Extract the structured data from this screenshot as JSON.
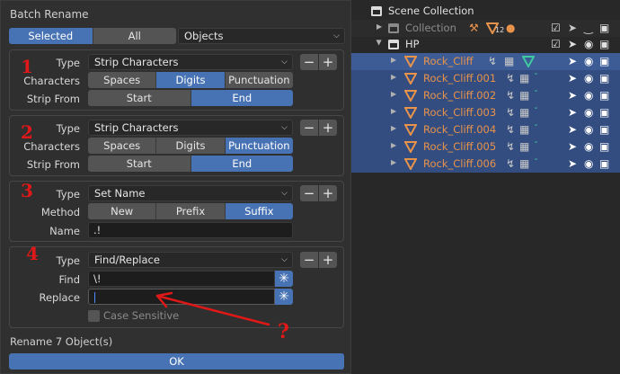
{
  "dialog": {
    "title": "Batch Rename",
    "target_tabs": [
      {
        "label": "Selected",
        "active": true
      },
      {
        "label": "All",
        "active": false
      }
    ],
    "data_type": "Objects",
    "footer_label": "Rename 7 Object(s)",
    "ok_label": "OK"
  },
  "annotations": {
    "n1": "1",
    "n2": "2",
    "n3": "3",
    "n4": "4",
    "question": "?"
  },
  "labels": {
    "type": "Type",
    "characters": "Characters",
    "strip_from": "Strip From",
    "method": "Method",
    "name": "Name",
    "find": "Find",
    "replace": "Replace",
    "case_sensitive": "Case Sensitive"
  },
  "panels": [
    {
      "type": "Strip Characters",
      "characters": [
        {
          "label": "Spaces",
          "active": false
        },
        {
          "label": "Digits",
          "active": true
        },
        {
          "label": "Punctuation",
          "active": false
        }
      ],
      "strip_from": [
        {
          "label": "Start",
          "active": false
        },
        {
          "label": "End",
          "active": true
        }
      ]
    },
    {
      "type": "Strip Characters",
      "characters": [
        {
          "label": "Spaces",
          "active": false
        },
        {
          "label": "Digits",
          "active": false
        },
        {
          "label": "Punctuation",
          "active": true
        }
      ],
      "strip_from": [
        {
          "label": "Start",
          "active": false
        },
        {
          "label": "End",
          "active": true
        }
      ]
    },
    {
      "type": "Set Name",
      "method": [
        {
          "label": "New",
          "active": false
        },
        {
          "label": "Prefix",
          "active": false
        },
        {
          "label": "Suffix",
          "active": true
        }
      ],
      "name_value": ".!"
    },
    {
      "type": "Find/Replace",
      "find_value": "\\!",
      "replace_value": "",
      "regex_icon": "asterisk-icon"
    }
  ],
  "buttons": {
    "minus": "−",
    "plus": "+"
  },
  "outliner": {
    "scene_collection": "Scene Collection",
    "collection": "Collection",
    "collection_count": "12",
    "hp": "HP",
    "objects": [
      "Rock_Cliff",
      "Rock_Cliff.001",
      "Rock_Cliff.002",
      "Rock_Cliff.003",
      "Rock_Cliff.004",
      "Rock_Cliff.005",
      "Rock_Cliff.006"
    ]
  },
  "colors": {
    "accent_blue": "#4772b3",
    "selection_row": "#334d80",
    "object_orange": "#e8934a",
    "annotation_red": "#e01818"
  }
}
